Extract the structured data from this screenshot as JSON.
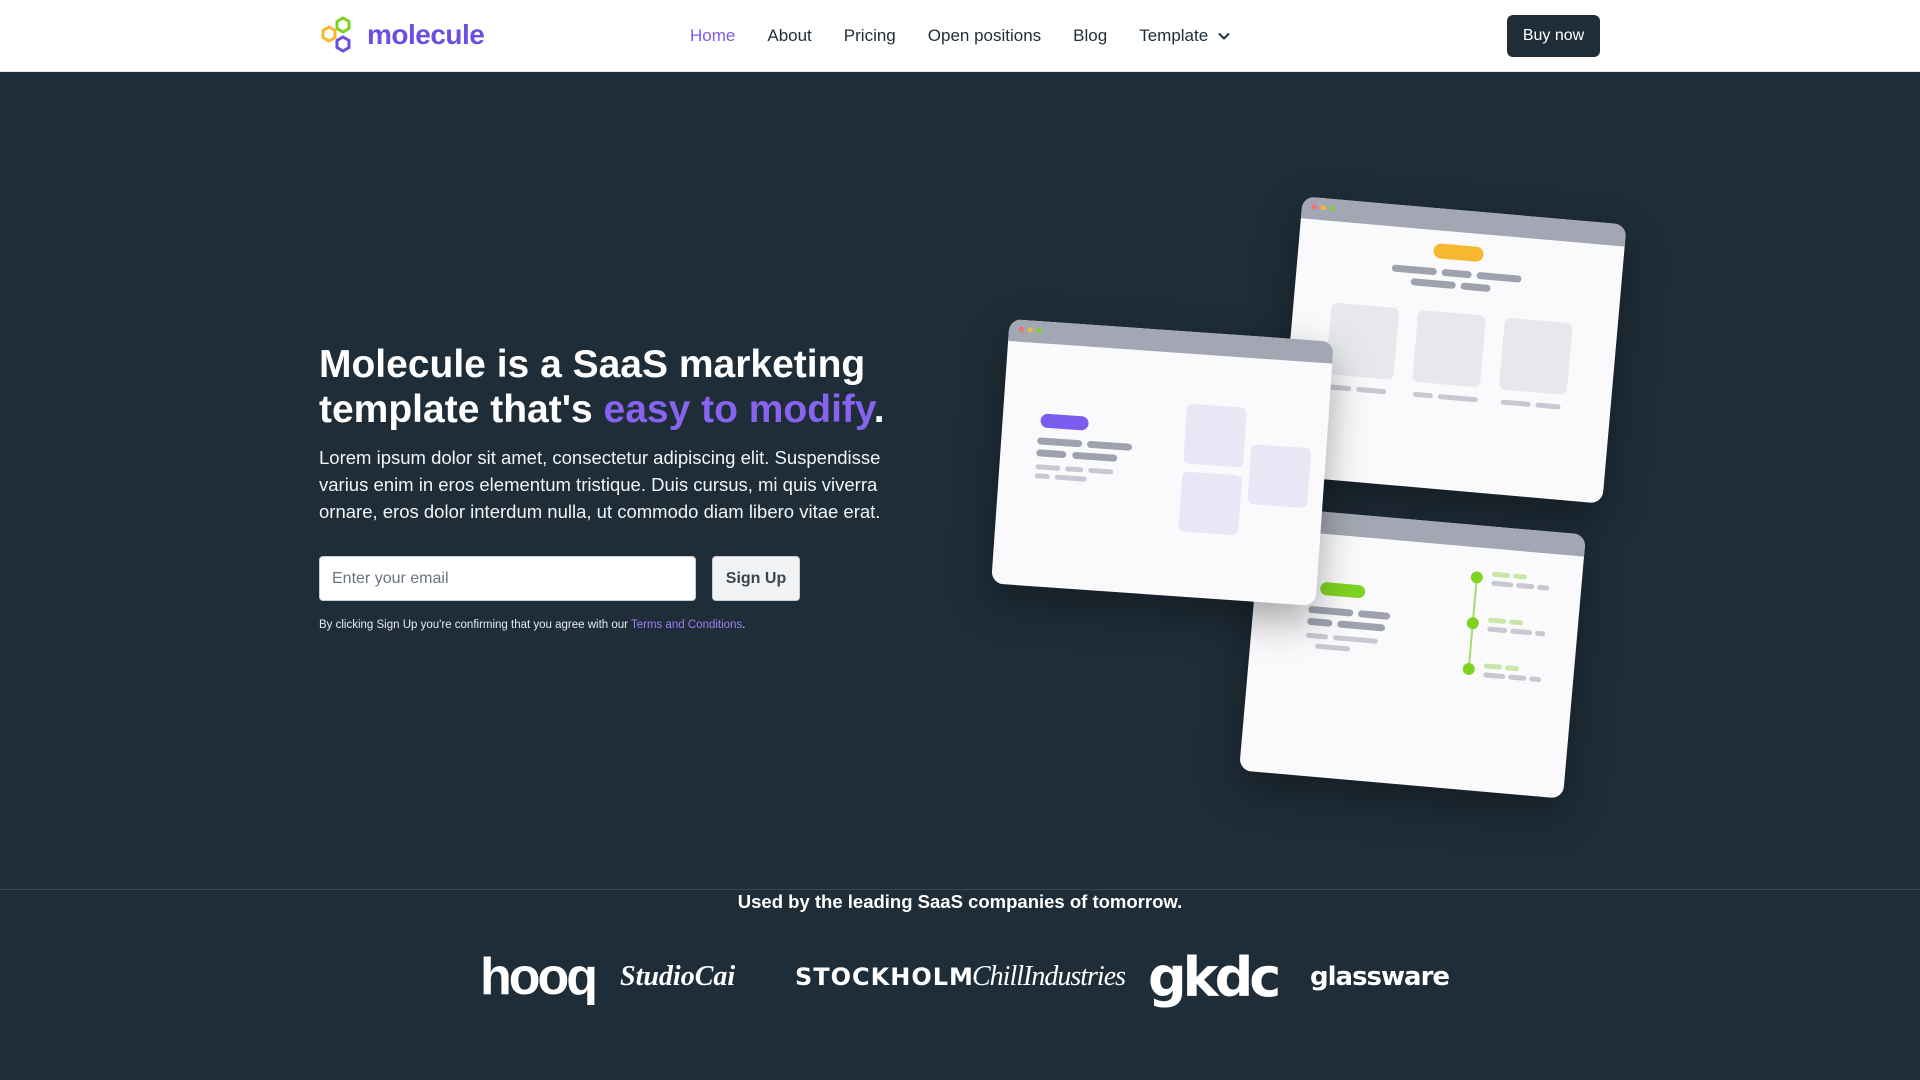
{
  "nav": {
    "brand": "molecule",
    "links": [
      "Home",
      "About",
      "Pricing",
      "Open positions",
      "Blog"
    ],
    "dropdown_label": "Template",
    "cta_label": "Buy now",
    "active_color": "#7b5cf0"
  },
  "hero": {
    "title_lead": "Molecule is a SaaS marketing template that's ",
    "title_accent": "easy to modify",
    "title_end": ".",
    "body": "Lorem ipsum dolor sit amet, consectetur adipiscing elit. Suspendisse varius enim in eros elementum tristique. Duis cursus, mi quis viverra ornare, eros dolor interdum nulla, ut commodo diam libero vitae erat.",
    "email_placeholder": "Enter your email",
    "signup_label": "Sign Up",
    "fine_print_lead": "By clicking Sign Up you're confirming that you agree with our ",
    "terms_link": "Terms and Conditions",
    "fine_print_end": ".",
    "accent_color": "#8763f0",
    "background_color": "#1f2d38"
  },
  "logos": {
    "heading": "Used by the leading SaaS companies of tomorrow.",
    "brands": [
      "hooq",
      "StudioCai",
      "STOCKHOLM",
      "ChillIndustries",
      "gkdc",
      "glassware"
    ]
  }
}
